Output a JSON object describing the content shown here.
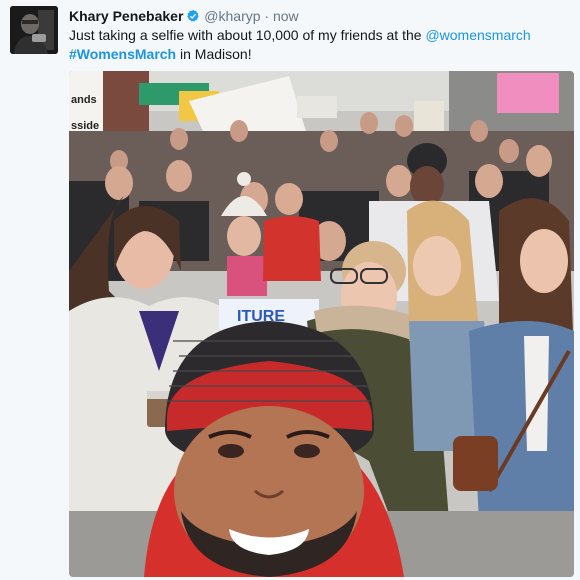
{
  "tweet": {
    "name": "Khary Penebaker",
    "handle": "@kharyp",
    "separator": "·",
    "time": "now",
    "text_part1": "Just taking a selfie with about 10,000 of my friends at the ",
    "mention": "@womensmarch",
    "hashtag": "#WomensMarch",
    "text_part2": " in Madison!"
  },
  "photo": {
    "signs": [
      "ands",
      "sside",
      "ITURE"
    ]
  },
  "colors": {
    "link": "#1b95e0",
    "verified": "#1da1f2",
    "muted": "#657786"
  }
}
